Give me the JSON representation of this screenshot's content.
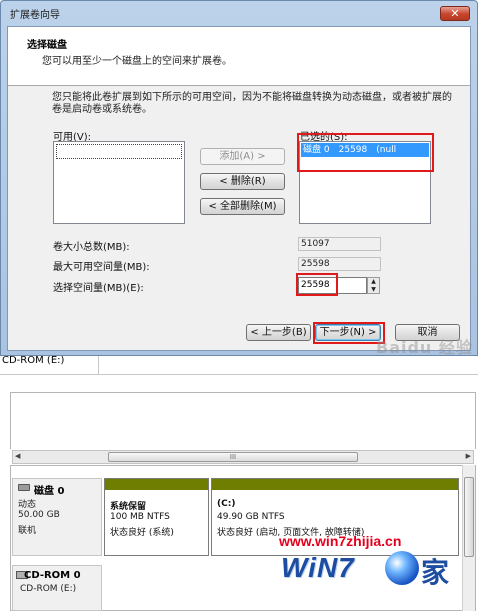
{
  "dialog": {
    "title": "扩展卷向导",
    "close_glyph": "✕",
    "header": {
      "title": "选择磁盘",
      "subtitle": "您可以用至少一个磁盘上的空间来扩展卷。"
    },
    "description": "您只能将此卷扩展到如下所示的可用空间，因为不能将磁盘转换为动态磁盘，或者被扩展的卷是启动卷或系统卷。",
    "available_label": "可用(V):",
    "selected_label": "已选的(S):",
    "selected_items": [
      {
        "name": "磁盘 0",
        "size": "25598",
        "extra": "(null"
      }
    ],
    "buttons": {
      "add": "添加(A) >",
      "remove": "< 删除(R)",
      "remove_all": "< 全部删除(M)",
      "back": "< 上一步(B)",
      "next": "下一步(N) >",
      "cancel": "取消"
    },
    "fields": {
      "total_label": "卷大小总数(MB):",
      "total_value": "51097",
      "max_label": "最大可用空间量(MB):",
      "max_value": "25598",
      "select_label": "选择空间量(MB)(E):",
      "select_value": "25598"
    },
    "watermark": "Baidu 经验"
  },
  "background": {
    "left_fragments": [
      "动",
      "5",
      "联"
    ],
    "cdrom_row": "CD-ROM (E:)"
  },
  "disk_mgmt": {
    "scroll_grip": "III",
    "disk0": {
      "title": "磁盘 0",
      "type": "动态",
      "size": "50.00 GB",
      "status": "联机",
      "partitions": [
        {
          "name": "系统保留",
          "size": "100 MB NTFS",
          "status": "状态良好 (系统)"
        },
        {
          "name": "(C:)",
          "size": "49.90 GB NTFS",
          "status": "状态良好 (启动, 页面文件, 故障转储)"
        }
      ]
    },
    "cdrom": {
      "title": "CD-ROM 0",
      "sub": "CD-ROM (E:)"
    }
  },
  "logo": {
    "url": "www.win7zhijia.cn",
    "win": "WiN7",
    "jia": "家"
  }
}
